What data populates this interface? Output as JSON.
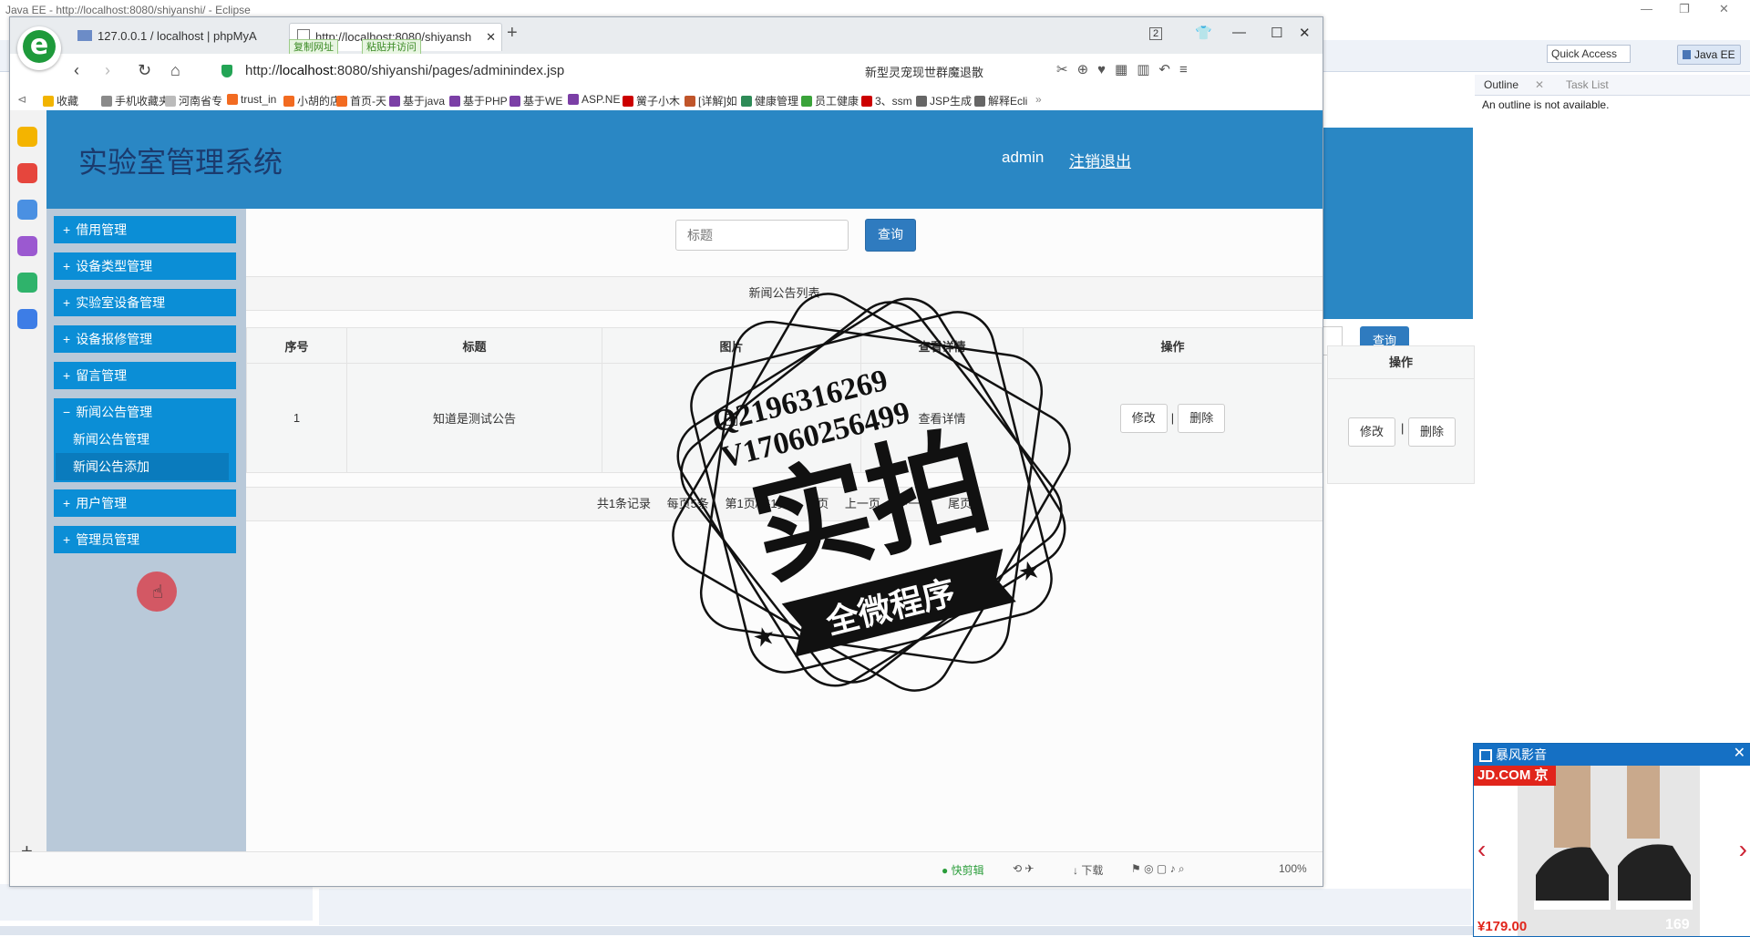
{
  "eclipse": {
    "title": "Java EE - http://localhost:8080/shiyanshi/ - Eclipse",
    "quick_access": "Quick Access",
    "perspective": "Java EE",
    "outline_tab": "Outline",
    "task_list_tab": "Task List",
    "outline_message": "An outline is not available.",
    "right_query_button": "查询",
    "right_op_header": "操作",
    "right_edit": "修改",
    "right_delete": "删除"
  },
  "browser": {
    "tabs": [
      {
        "label": "127.0.0.1 / localhost | phpMyA"
      },
      {
        "label": "http://localhost:8080/shiyansh"
      }
    ],
    "copy_url": "复制网址",
    "paste_go": "粘贴并访问",
    "tab_count": "2",
    "url_prefix": "http://",
    "url_host": "localhost",
    "url_rest": ":8080/shiyanshi/pages/adminindex.jsp",
    "search_text": "新型灵宠现世群魔退散",
    "bookmarks": [
      "收藏",
      "手机收藏夹",
      "河南省专",
      "trust_in",
      "小胡的店",
      "首页-天",
      "基于java",
      "基于PHP",
      "基于WE",
      "ASP.NE",
      "黉子小木",
      "[详解]如",
      "健康管理",
      "员工健康",
      "3、ssm",
      "JSP生成",
      "解释Ecli"
    ],
    "status": {
      "quick_clip": "快剪辑",
      "download": "下载",
      "zoom": "100%"
    }
  },
  "app": {
    "title": "实验室管理系统",
    "user": "admin",
    "logout": "注销退出",
    "menu": [
      {
        "sign": "+",
        "label": "借用管理"
      },
      {
        "sign": "+",
        "label": "设备类型管理"
      },
      {
        "sign": "+",
        "label": "实验室设备管理"
      },
      {
        "sign": "+",
        "label": "设备报修管理"
      },
      {
        "sign": "+",
        "label": "留言管理"
      },
      {
        "sign": "−",
        "label": "新闻公告管理"
      },
      {
        "sign": "+",
        "label": "用户管理"
      },
      {
        "sign": "+",
        "label": "管理员管理"
      }
    ],
    "submenu": [
      "新闻公告管理",
      "新闻公告添加"
    ],
    "search_placeholder": "标题",
    "search_button": "查询",
    "list_caption": "新闻公告列表",
    "columns": [
      "序号",
      "标题",
      "图片",
      "查看详情",
      "操作"
    ],
    "rows": [
      {
        "index": "1",
        "title": "知道是测试公告",
        "detail": "查看详情",
        "edit": "修改",
        "delete": "删除"
      }
    ],
    "pager": [
      "共1条记录",
      "每页5条",
      "第1页/共1页",
      "首页",
      "上一页",
      "下一页",
      "尾页"
    ]
  },
  "watermark": {
    "qq": "Q2196316269",
    "wechat": "V17060256499",
    "main": "实拍",
    "banner": "全微程序"
  },
  "ad": {
    "title": "暴风影音",
    "brand": "JD.COM 京东",
    "price": "¥179.00",
    "price2": "169"
  }
}
